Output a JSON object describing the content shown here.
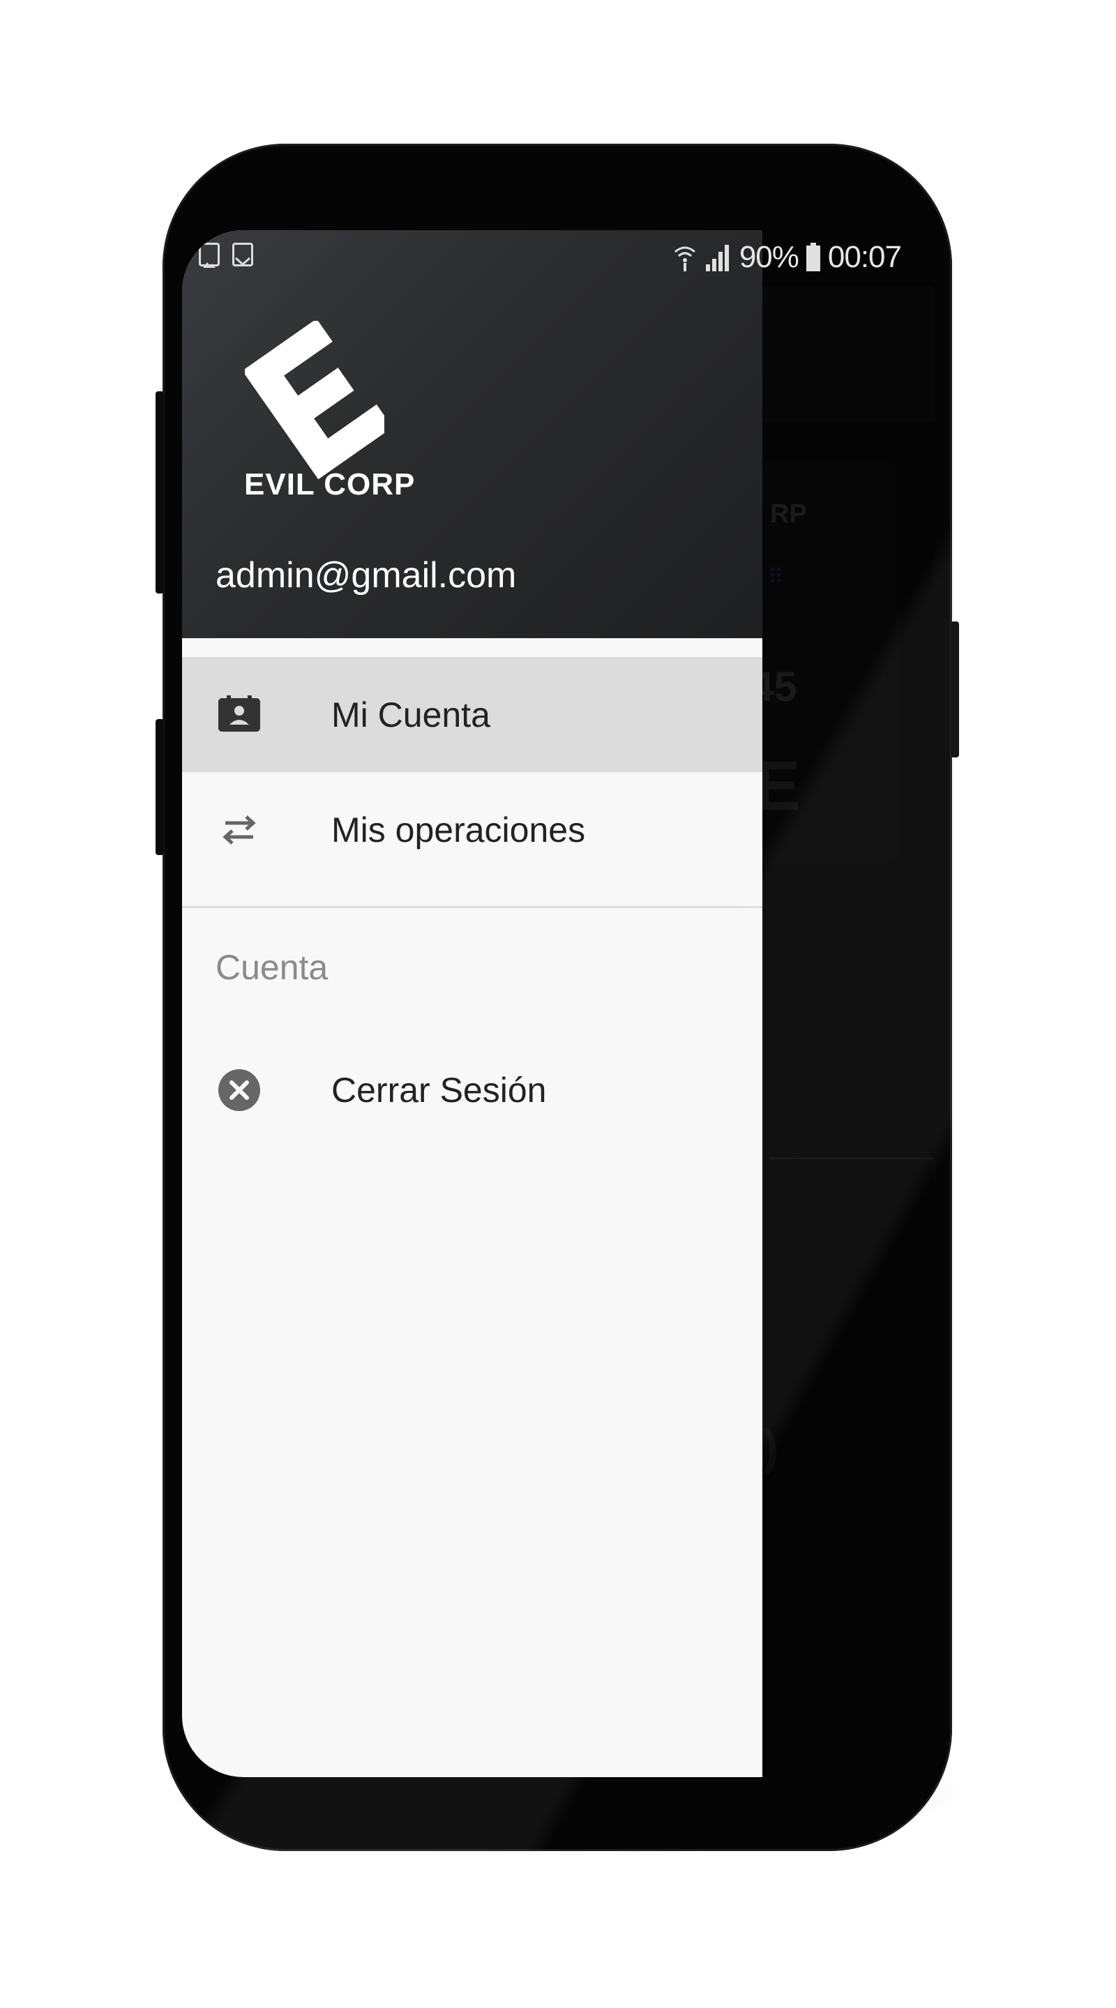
{
  "status_bar": {
    "left_icons": [
      "image-icon",
      "gmail-icon"
    ],
    "right_icons": [
      "wifi-icon",
      "signal-icon"
    ],
    "battery": "90%",
    "time": "00:07"
  },
  "drawer": {
    "brand": "EVIL CORP",
    "email": "admin@gmail.com",
    "items": [
      {
        "label": "Mi Cuenta",
        "icon": "account-box-icon",
        "active": true
      },
      {
        "label": "Mis operaciones",
        "icon": "swap-arrows-icon",
        "active": false
      }
    ],
    "section_title": "Cuenta",
    "logout": {
      "label": "Cerrar Sesión",
      "icon": "close-circle-icon"
    }
  },
  "background_app": {
    "card_title": "RP",
    "card_number": "45"
  },
  "colors": {
    "drawer_header": "#2b2c2e",
    "drawer_body": "#f8f8f8",
    "active_item": "#dcdcdc",
    "icon_gray": "#666666"
  }
}
